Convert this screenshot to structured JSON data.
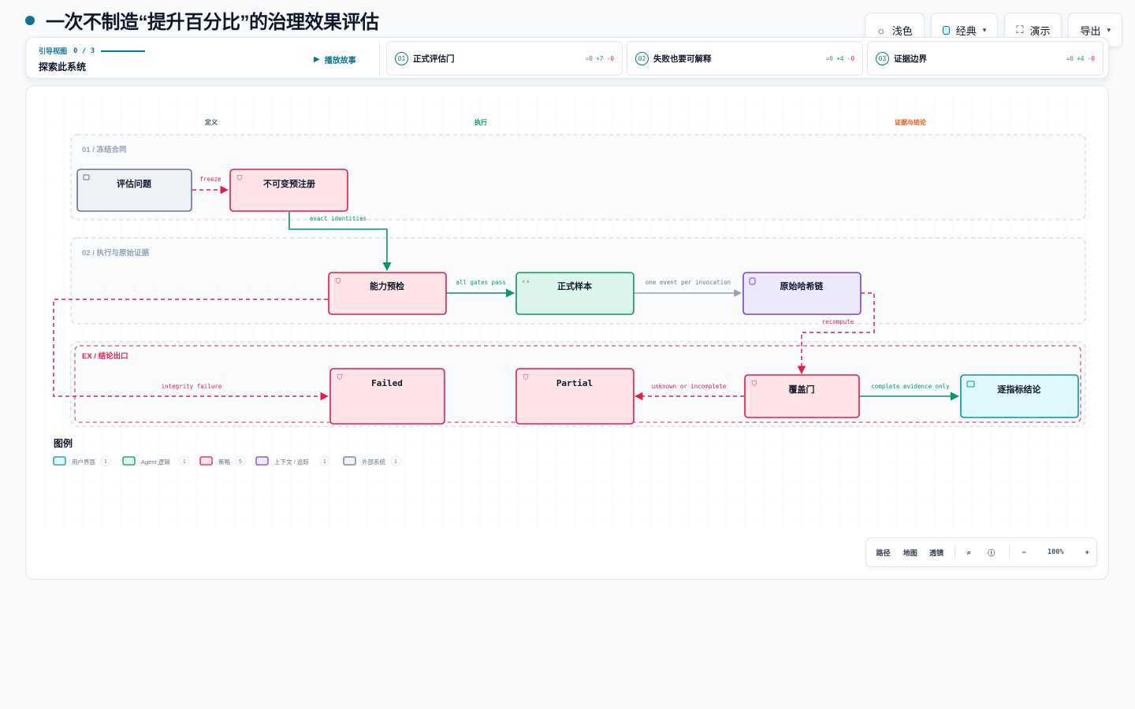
{
  "page": {
    "title": "一次不制造“提升百分比”的治理效果评估"
  },
  "toolbar": {
    "theme_label": "浅色",
    "style_label": "经典",
    "present_label": "演示",
    "export_label": "导出",
    "theme_icon": "sun-icon",
    "present_icon": "fullscreen-icon"
  },
  "story": {
    "guide_label": "引导视图",
    "guide_count": "0 / 3",
    "guide_subtitle": "探索此系统",
    "play_label": "播放故事",
    "steps": [
      {
        "num": "01",
        "label": "正式评估门",
        "eq": "=0",
        "plus": "+7",
        "minus": "-0"
      },
      {
        "num": "02",
        "label": "失败也要可解释",
        "eq": "=0",
        "plus": "+4",
        "minus": "-0"
      },
      {
        "num": "03",
        "label": "证据边界",
        "eq": "=0",
        "plus": "+4",
        "minus": "-0"
      }
    ]
  },
  "diagram": {
    "columns": {
      "definition": "定义",
      "execution": "执行",
      "evidence": "证据与结论"
    },
    "groups": {
      "g1": "01 / 冻结合同",
      "g2": "02 / 执行与原始证据",
      "ex": "EX / 结论出口"
    },
    "nodes": {
      "eval_question": "评估问题",
      "immutable_registration": "不可变预注册",
      "capability_precheck": "能力预检",
      "formal_sample": "正式样本",
      "raw_hash_chain": "原始哈希链",
      "failed": "Failed",
      "partial": "Partial",
      "coverage_gate": "覆盖门",
      "per_metric_conclusion": "逐指标结论"
    },
    "edges": {
      "freeze": "freeze",
      "exact_identities": "exact identities",
      "all_gates_pass": "all gates pass",
      "one_event": "one event per invocation",
      "recompute": "recompute",
      "integrity_failure": "integrity failure",
      "unknown_incomplete": "unknown or incomplete",
      "complete_evidence": "complete evidence only"
    },
    "colors": {
      "ui": "#0891b2",
      "agent": "#059669",
      "policy": "#e11d48",
      "context": "#7c3aed",
      "external": "#64748b",
      "accent": "#0e7490"
    }
  },
  "legend": {
    "title": "图例",
    "items": [
      {
        "label": "用户界面",
        "count": "1"
      },
      {
        "label": "Agent 逻辑",
        "count": "1"
      },
      {
        "label": "策略",
        "count": "5"
      },
      {
        "label": "上下文 / 追踪",
        "count": "1"
      },
      {
        "label": "外部系统",
        "count": "1"
      }
    ]
  },
  "zoom": {
    "path_label": "路径",
    "map_label": "地图",
    "lens_label": "透镜",
    "level": "100%",
    "minus_label": "−",
    "plus_label": "+",
    "search_icon": "search-icon",
    "help_icon": "help-icon"
  }
}
